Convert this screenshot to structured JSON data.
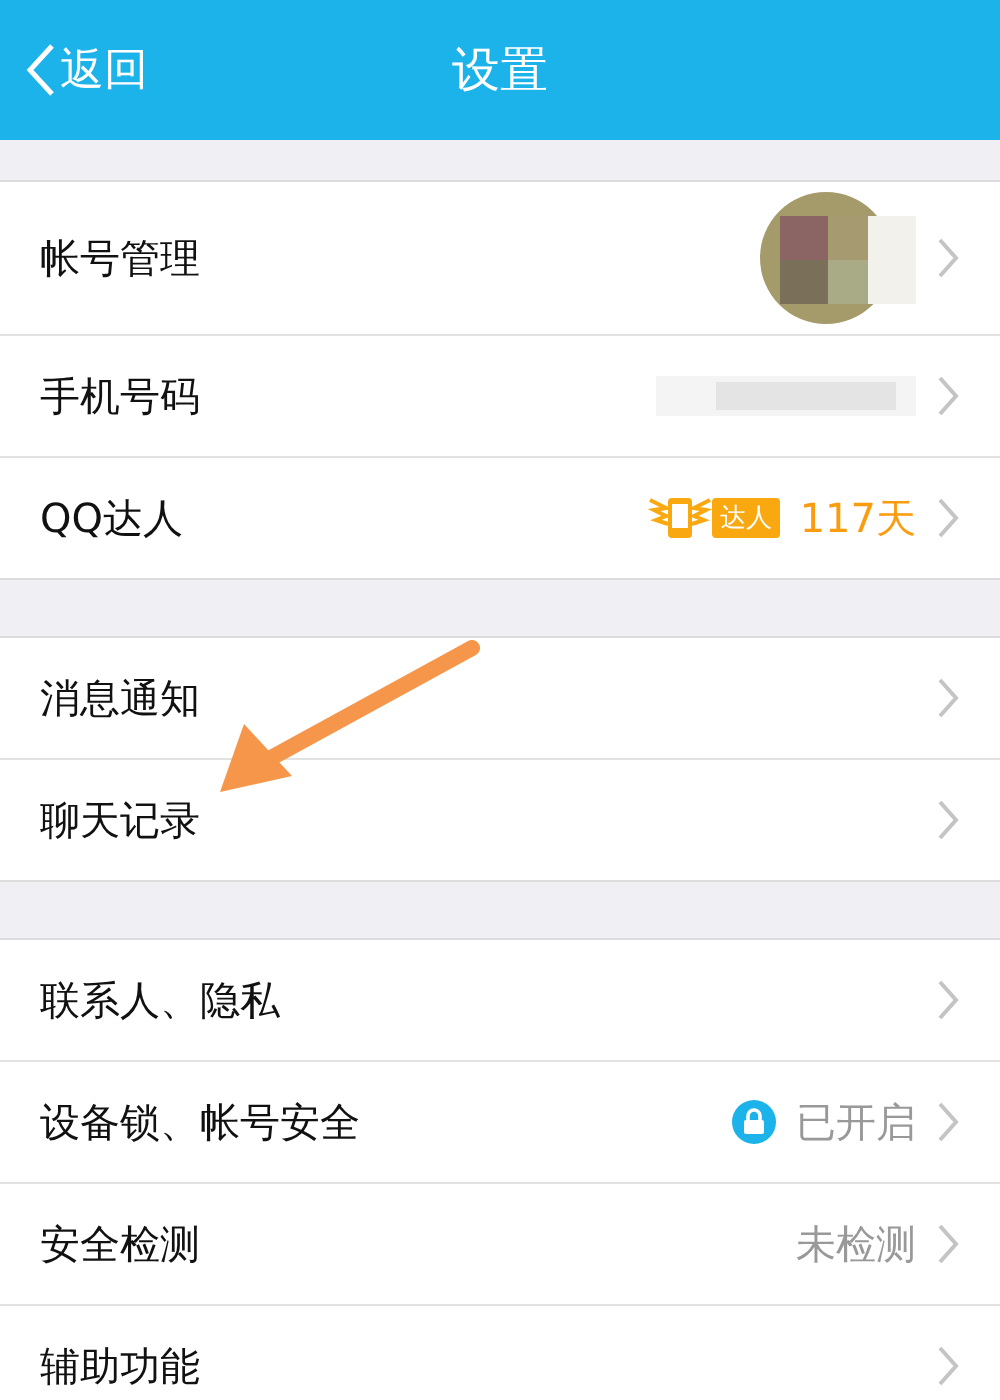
{
  "nav": {
    "back": "返回",
    "title": "设置"
  },
  "groups": [
    {
      "rows": [
        {
          "label": "帐号管理",
          "kind": "avatar"
        },
        {
          "label": "手机号码",
          "kind": "redacted"
        },
        {
          "label": "QQ达人",
          "kind": "badge",
          "badge": "达人",
          "value": "117天"
        }
      ]
    },
    {
      "rows": [
        {
          "label": "消息通知",
          "kind": "plain"
        },
        {
          "label": "聊天记录",
          "kind": "plain"
        }
      ]
    },
    {
      "rows": [
        {
          "label": "联系人、隐私",
          "kind": "plain"
        },
        {
          "label": "设备锁、帐号安全",
          "kind": "lock",
          "value": "已开启"
        },
        {
          "label": "安全检测",
          "kind": "value",
          "value": "未检测"
        },
        {
          "label": "辅助功能",
          "kind": "plain"
        }
      ]
    }
  ]
}
